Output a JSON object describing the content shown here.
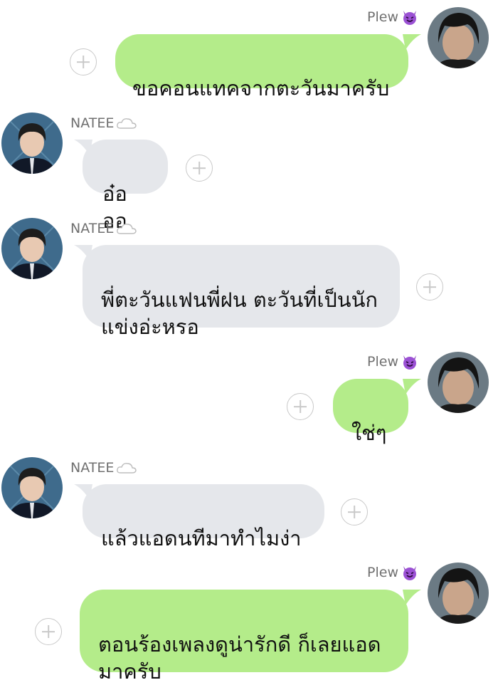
{
  "contacts": {
    "me": {
      "name": "Plew",
      "name_icon": "smiling-devil-emoji"
    },
    "other": {
      "name": "NATEE",
      "name_icon": "cloud-emoji"
    }
  },
  "messages": [
    {
      "from": "me",
      "text": "ขอคอนแทคจากตะวันมาครับ"
    },
    {
      "from": "other",
      "text": "อ๋อออ"
    },
    {
      "from": "other",
      "text": "พี่ตะวันแฟนพี่ฝน ตะวันที่เป็นนัก\nแข่งอ่ะหรอ"
    },
    {
      "from": "me",
      "text": "ใช่ๆ"
    },
    {
      "from": "other",
      "text": "แล้วแอดนทีมาทำไมง่า"
    },
    {
      "from": "me",
      "text": "ตอนร้องเพลงดูน่ารักดี ก็เลยแอด\nมาครับ"
    }
  ],
  "colors": {
    "outgoing_bubble": "#B4EC8A",
    "incoming_bubble": "#E5E7EB",
    "sender_name": "#707070",
    "background": "#FFFFFF"
  }
}
